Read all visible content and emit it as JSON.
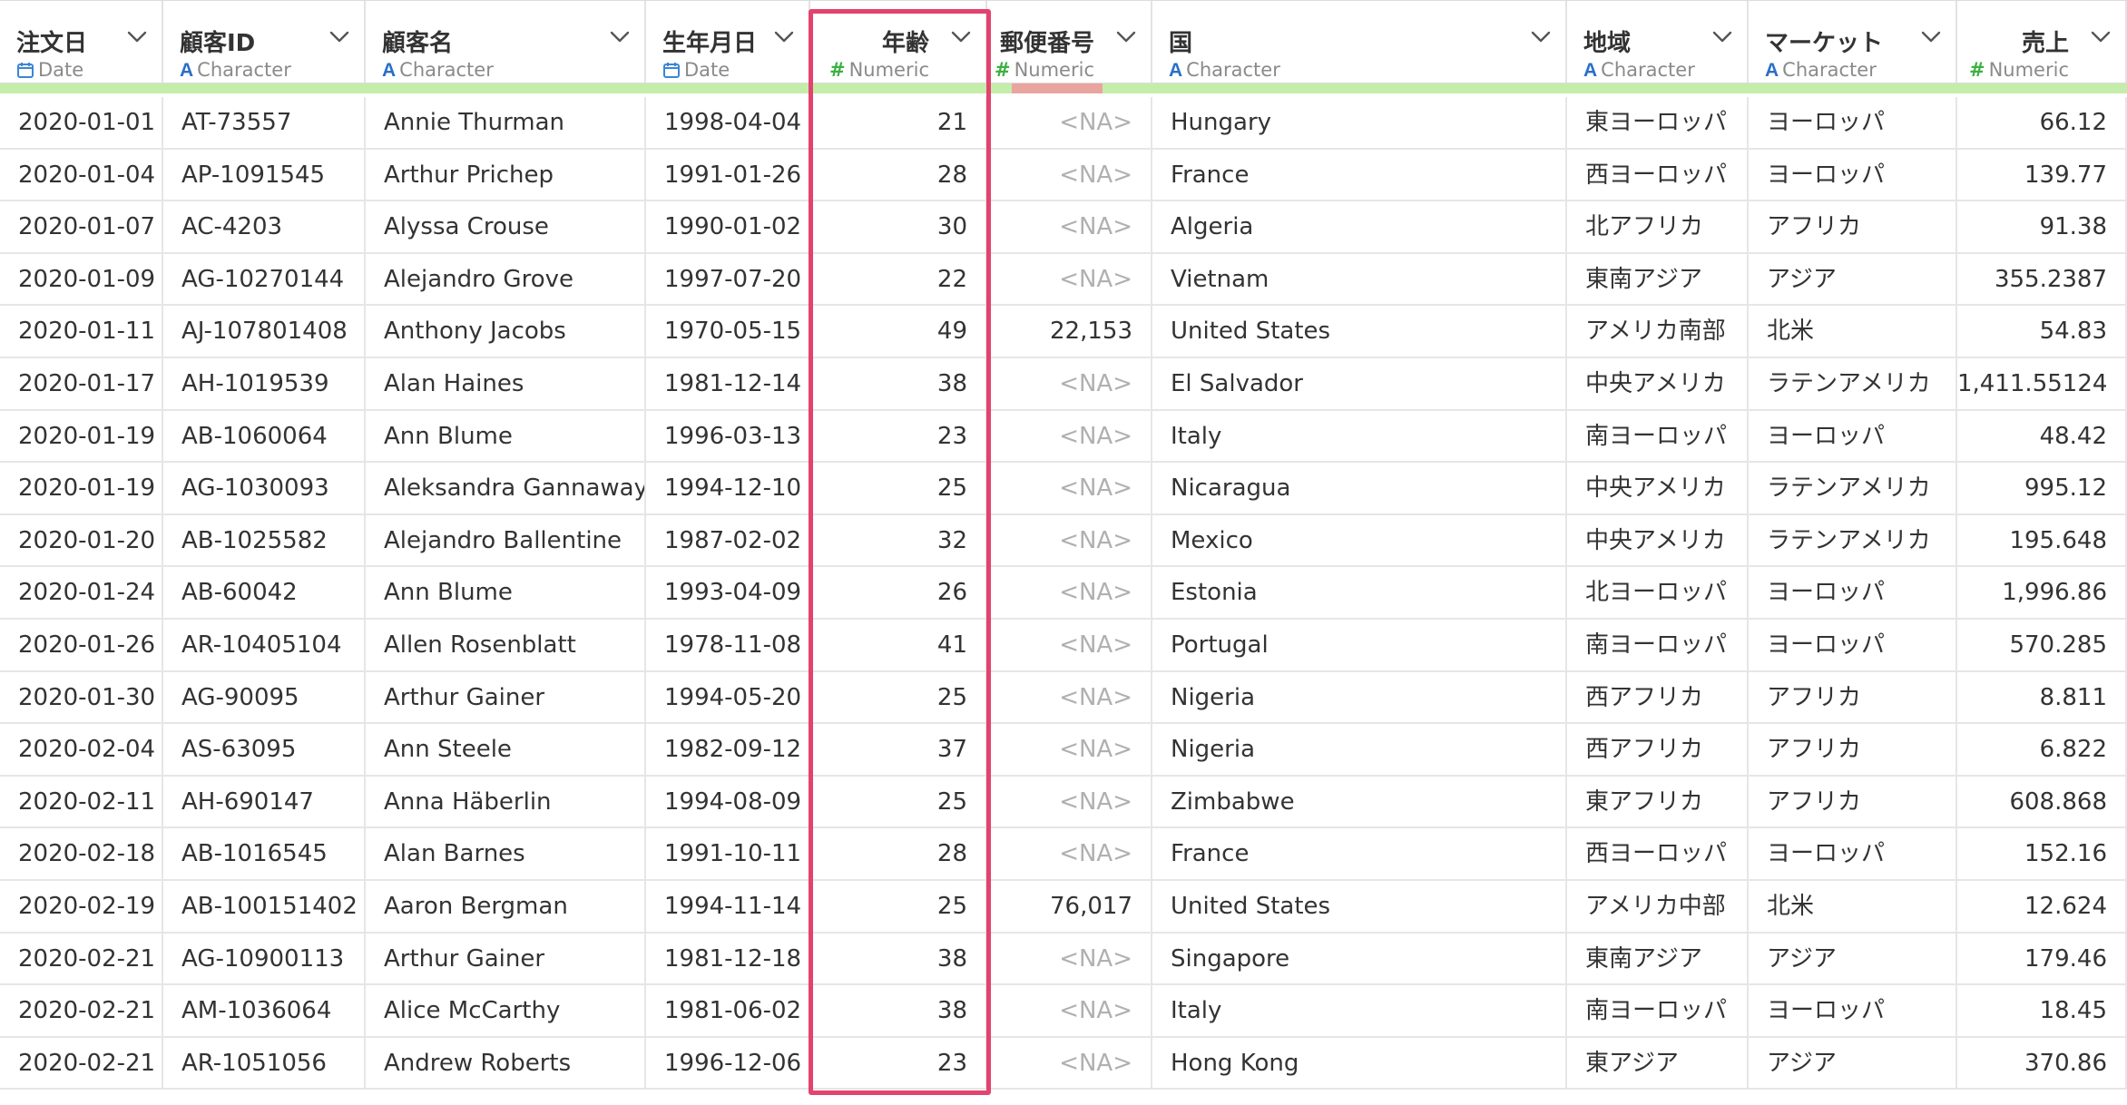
{
  "table": {
    "columns": [
      {
        "name": "注文日",
        "type": "Date",
        "icon": "calendar-icon",
        "align": "left"
      },
      {
        "name": "顧客ID",
        "type": "Character",
        "icon": "character-type-icon",
        "align": "left"
      },
      {
        "name": "顧客名",
        "type": "Character",
        "icon": "character-type-icon",
        "align": "left"
      },
      {
        "name": "生年月日",
        "type": "Date",
        "icon": "calendar-icon",
        "align": "left"
      },
      {
        "name": "年齢",
        "type": "Numeric",
        "icon": "numeric-type-icon",
        "align": "right"
      },
      {
        "name": "郵便番号",
        "type": "Numeric",
        "icon": "numeric-type-icon",
        "align": "right"
      },
      {
        "name": "国",
        "type": "Character",
        "icon": "character-type-icon",
        "align": "left"
      },
      {
        "name": "地域",
        "type": "Character",
        "icon": "character-type-icon",
        "align": "left"
      },
      {
        "name": "マーケット",
        "type": "Character",
        "icon": "character-type-icon",
        "align": "left"
      },
      {
        "name": "売上",
        "type": "Numeric",
        "icon": "numeric-type-icon",
        "align": "right"
      }
    ],
    "quality": [
      {
        "valid_fraction": 1.0
      },
      {
        "valid_fraction": 1.0
      },
      {
        "valid_fraction": 1.0
      },
      {
        "valid_fraction": 1.0
      },
      {
        "valid_fraction": 1.0
      },
      {
        "valid_fraction": 0.15
      },
      {
        "valid_fraction": 1.0
      },
      {
        "valid_fraction": 1.0
      },
      {
        "valid_fraction": 1.0
      },
      {
        "valid_fraction": 1.0
      }
    ],
    "rows": [
      [
        "2020-01-01",
        "AT-73557",
        "Annie Thurman",
        "1998-04-04",
        "21",
        "<NA>",
        "Hungary",
        "東ヨーロッパ",
        "ヨーロッパ",
        "66.12"
      ],
      [
        "2020-01-04",
        "AP-1091545",
        "Arthur Prichep",
        "1991-01-26",
        "28",
        "<NA>",
        "France",
        "西ヨーロッパ",
        "ヨーロッパ",
        "139.77"
      ],
      [
        "2020-01-07",
        "AC-4203",
        "Alyssa Crouse",
        "1990-01-02",
        "30",
        "<NA>",
        "Algeria",
        "北アフリカ",
        "アフリカ",
        "91.38"
      ],
      [
        "2020-01-09",
        "AG-10270144",
        "Alejandro Grove",
        "1997-07-20",
        "22",
        "<NA>",
        "Vietnam",
        "東南アジア",
        "アジア",
        "355.2387"
      ],
      [
        "2020-01-11",
        "AJ-107801408",
        "Anthony Jacobs",
        "1970-05-15",
        "49",
        "22,153",
        "United States",
        "アメリカ南部",
        "北米",
        "54.83"
      ],
      [
        "2020-01-17",
        "AH-1019539",
        "Alan Haines",
        "1981-12-14",
        "38",
        "<NA>",
        "El Salvador",
        "中央アメリカ",
        "ラテンアメリカ",
        "1,411.55124"
      ],
      [
        "2020-01-19",
        "AB-1060064",
        "Ann Blume",
        "1996-03-13",
        "23",
        "<NA>",
        "Italy",
        "南ヨーロッパ",
        "ヨーロッパ",
        "48.42"
      ],
      [
        "2020-01-19",
        "AG-1030093",
        "Aleksandra Gannaway",
        "1994-12-10",
        "25",
        "<NA>",
        "Nicaragua",
        "中央アメリカ",
        "ラテンアメリカ",
        "995.12"
      ],
      [
        "2020-01-20",
        "AB-1025582",
        "Alejandro Ballentine",
        "1987-02-02",
        "32",
        "<NA>",
        "Mexico",
        "中央アメリカ",
        "ラテンアメリカ",
        "195.648"
      ],
      [
        "2020-01-24",
        "AB-60042",
        "Ann Blume",
        "1993-04-09",
        "26",
        "<NA>",
        "Estonia",
        "北ヨーロッパ",
        "ヨーロッパ",
        "1,996.86"
      ],
      [
        "2020-01-26",
        "AR-10405104",
        "Allen Rosenblatt",
        "1978-11-08",
        "41",
        "<NA>",
        "Portugal",
        "南ヨーロッパ",
        "ヨーロッパ",
        "570.285"
      ],
      [
        "2020-01-30",
        "AG-90095",
        "Arthur Gainer",
        "1994-05-20",
        "25",
        "<NA>",
        "Nigeria",
        "西アフリカ",
        "アフリカ",
        "8.811"
      ],
      [
        "2020-02-04",
        "AS-63095",
        "Ann Steele",
        "1982-09-12",
        "37",
        "<NA>",
        "Nigeria",
        "西アフリカ",
        "アフリカ",
        "6.822"
      ],
      [
        "2020-02-11",
        "AH-690147",
        "Anna Häberlin",
        "1994-08-09",
        "25",
        "<NA>",
        "Zimbabwe",
        "東アフリカ",
        "アフリカ",
        "608.868"
      ],
      [
        "2020-02-18",
        "AB-1016545",
        "Alan Barnes",
        "1991-10-11",
        "28",
        "<NA>",
        "France",
        "西ヨーロッパ",
        "ヨーロッパ",
        "152.16"
      ],
      [
        "2020-02-19",
        "AB-100151402",
        "Aaron Bergman",
        "1994-11-14",
        "25",
        "76,017",
        "United States",
        "アメリカ中部",
        "北米",
        "12.624"
      ],
      [
        "2020-02-21",
        "AG-10900113",
        "Arthur Gainer",
        "1981-12-18",
        "38",
        "<NA>",
        "Singapore",
        "東南アジア",
        "アジア",
        "179.46"
      ],
      [
        "2020-02-21",
        "AM-1036064",
        "Alice McCarthy",
        "1981-06-02",
        "38",
        "<NA>",
        "Italy",
        "南ヨーロッパ",
        "ヨーロッパ",
        "18.45"
      ],
      [
        "2020-02-21",
        "AR-1051056",
        "Andrew Roberts",
        "1996-12-06",
        "23",
        "<NA>",
        "Hong Kong",
        "東アジア",
        "アジア",
        "370.86"
      ]
    ],
    "na_label": "<NA>",
    "highlighted_column": "年齢"
  },
  "colors": {
    "quality_valid": "#c4edaa",
    "quality_missing": "#eaa4a0",
    "highlight_border": "#e2436f",
    "na_text": "#b0b0b0"
  }
}
